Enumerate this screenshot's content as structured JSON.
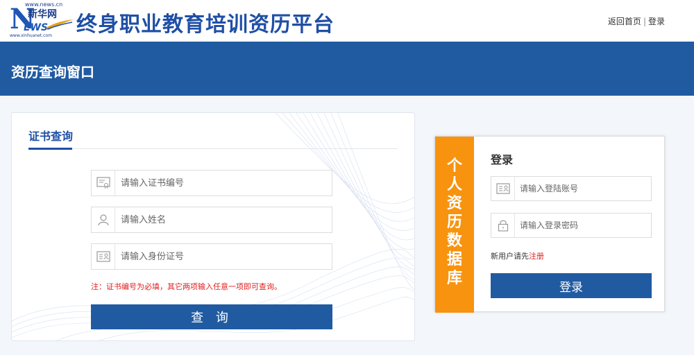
{
  "header": {
    "logo_domain": "www.news.cn",
    "logo_cn": "新华网",
    "logo_letter": "N",
    "logo_ews": "EWS",
    "logo_url": "www.xinhuanet.com",
    "site_title": "终身职业教育培训资历平台",
    "link_home": "返回首页",
    "link_sep": "|",
    "link_login": "登录"
  },
  "banner": {
    "title": "资历查询窗口"
  },
  "query": {
    "tab_label": "证书查询",
    "fields": [
      {
        "placeholder": "请输入证书编号",
        "icon": "certificate-icon"
      },
      {
        "placeholder": "请输入姓名",
        "icon": "user-icon"
      },
      {
        "placeholder": "请输入身份证号",
        "icon": "id-card-icon"
      }
    ],
    "note": "注：证书编号为必填，其它两项输入任意一项即可查询。",
    "button_label": "查 询"
  },
  "login": {
    "side_chars": [
      "个",
      "人",
      "资",
      "历",
      "数",
      "据",
      "库"
    ],
    "title": "登录",
    "account_placeholder": "请输入登陆账号",
    "password_placeholder": "请输入登录密码",
    "register_prefix": "新用户请先",
    "register_link": "注册",
    "button_label": "登录"
  },
  "colors": {
    "primary_blue": "#205ba2",
    "accent_orange": "#f8930f",
    "warning_red": "#e02020"
  }
}
